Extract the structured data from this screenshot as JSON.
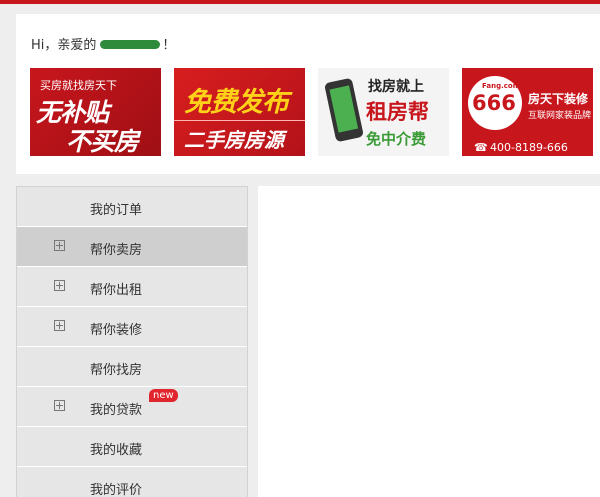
{
  "header": {
    "greeting_prefix": "Hi，亲爱的",
    "greeting_suffix": "！"
  },
  "banners": [
    {
      "line1": "买房就找房天下",
      "line2": "无补贴",
      "line3": "不买房"
    },
    {
      "line1": "免费发布",
      "line2": "二手房房源"
    },
    {
      "line1": "找房就上",
      "line2": "租房帮",
      "line3": "免中介费"
    },
    {
      "logo": "Fang.com",
      "number": "666",
      "line1": "房天下装修",
      "line2": "互联网家装品牌",
      "phone": "400-8189-666"
    }
  ],
  "menu": [
    {
      "label": "我的订单",
      "expandable": false
    },
    {
      "label": "帮你卖房",
      "expandable": true
    },
    {
      "label": "帮你出租",
      "expandable": true
    },
    {
      "label": "帮你装修",
      "expandable": true
    },
    {
      "label": "帮你找房",
      "expandable": false
    },
    {
      "label": "我的贷款",
      "expandable": true,
      "badge": "new"
    },
    {
      "label": "我的收藏",
      "expandable": false
    },
    {
      "label": "我的评价",
      "expandable": false
    }
  ],
  "colors": {
    "brand_red": "#c8161d",
    "username_mask": "#2e8b3c"
  }
}
